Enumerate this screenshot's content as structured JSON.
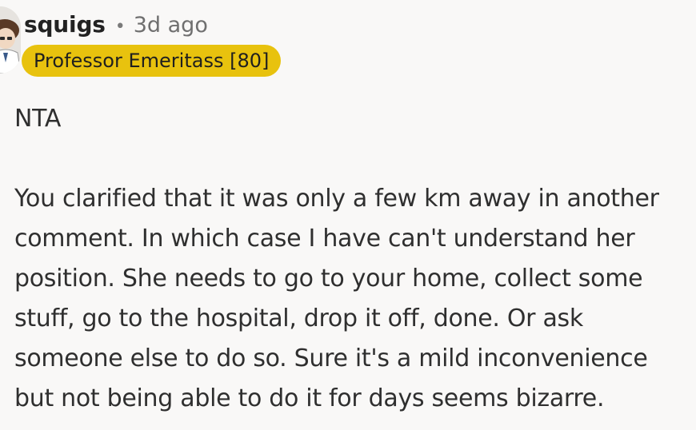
{
  "comment": {
    "username": "squigs",
    "separator": "•",
    "timestamp": "3d ago",
    "flair": "Professor Emeritass [80]",
    "flair_color": "#e8c20e",
    "verdict": "NTA",
    "body": "You clarified that it was only a few km away in another comment. In which case I have can't understand her position. She needs to go to your home, collect some stuff, go to the hospital, drop it off, done. Or ask someone else to do so. Sure it's a mild inconvenience but not being able to do it for days seems bizarre.",
    "avatar_icon": "user-avatar-icon"
  }
}
